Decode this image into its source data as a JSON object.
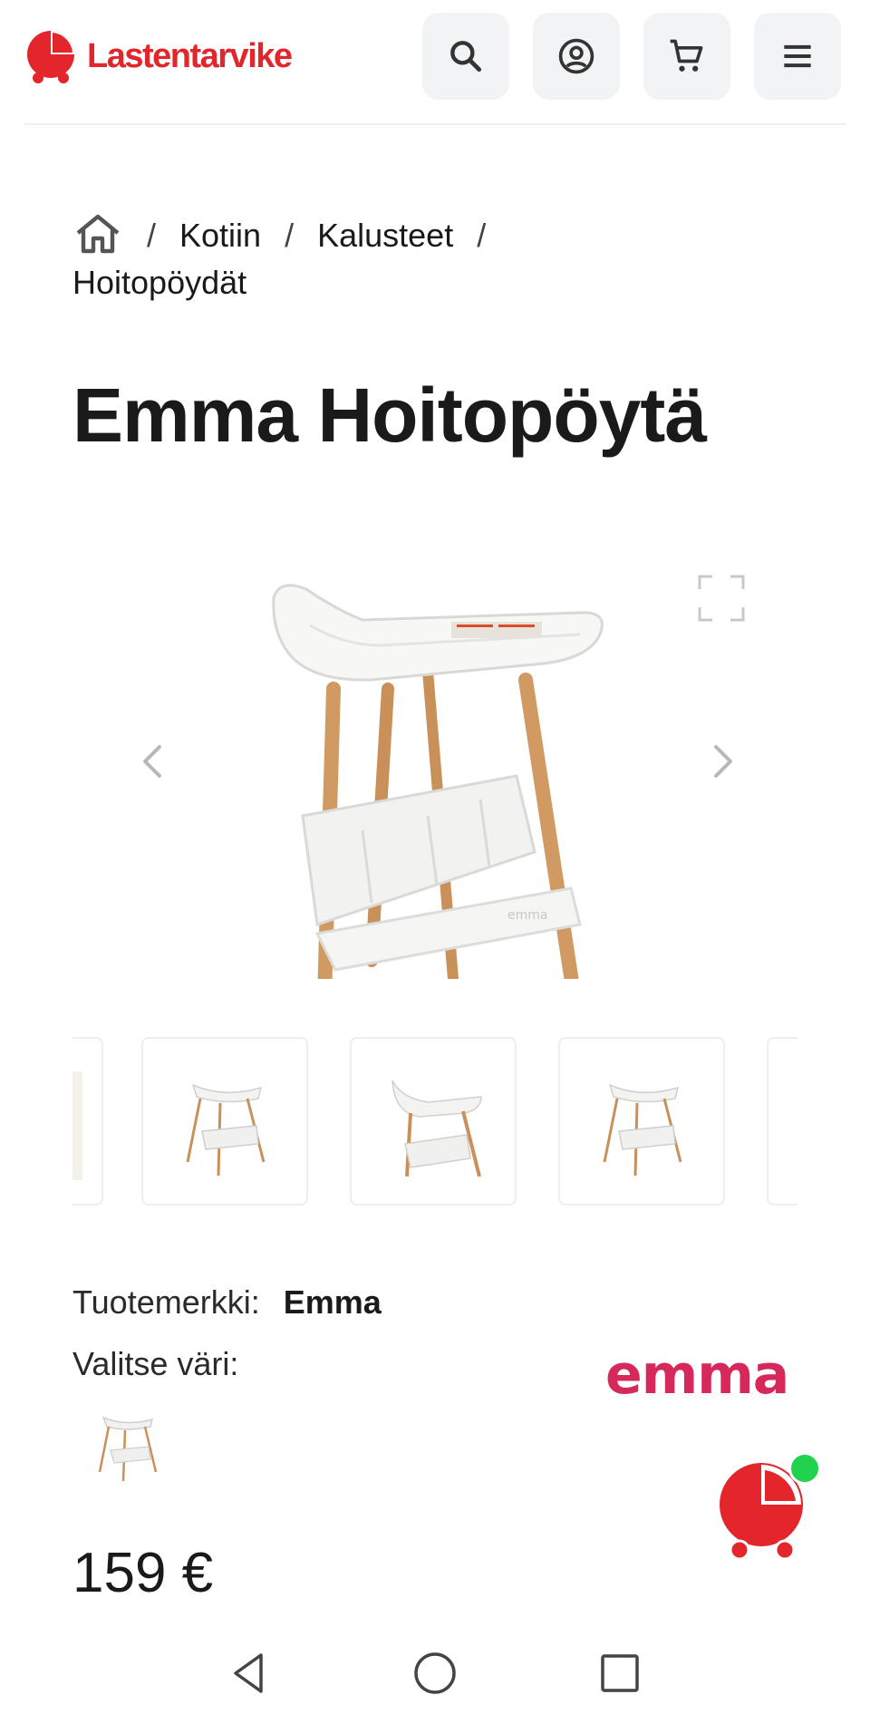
{
  "header": {
    "logo_text": "Lastentarvike",
    "brand_color": "#e3262b",
    "icons": [
      "search-icon",
      "account-icon",
      "cart-icon",
      "menu-icon"
    ]
  },
  "breadcrumb": {
    "items": [
      "Kotiin",
      "Kalusteet",
      "Hoitopöydät"
    ],
    "separator": "/"
  },
  "product": {
    "title": "Emma Hoitopöytä",
    "brand_label": "Tuotemerkki:",
    "brand_value": "Emma",
    "color_label": "Valitse väri:",
    "brand_logo_text": "emma",
    "brand_logo_color": "#d6285a",
    "price": "159 €"
  },
  "gallery": {
    "thumbnail_count_visible": 5
  },
  "chat": {
    "status_color": "#21d24f"
  }
}
